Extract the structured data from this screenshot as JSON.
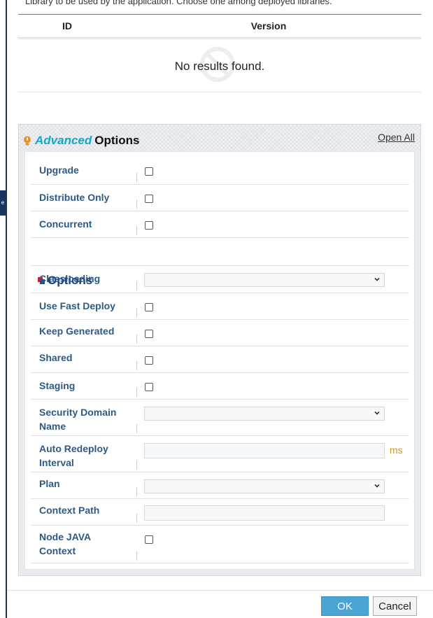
{
  "library": {
    "description": "Library to be used by the application. Choose one among deployed libraries.",
    "columns": [
      "ID",
      "Version"
    ],
    "empty_text": "No results found."
  },
  "advanced": {
    "title_part1": "Advanced",
    "title_part2": "Options",
    "open_all": "Open All",
    "rows_top": [
      {
        "label": "Upgrade",
        "control": "checkbox",
        "checked": false
      },
      {
        "label": "Distribute Only",
        "control": "checkbox",
        "checked": false
      },
      {
        "label": "Concurrent",
        "control": "checkbox",
        "checked": false
      }
    ],
    "options_title": "Options",
    "rows_options": [
      {
        "label": "Classloading",
        "control": "select",
        "value": ""
      },
      {
        "label": "Use Fast Deploy",
        "control": "checkbox",
        "checked": false
      },
      {
        "label": "Keep Generated",
        "control": "checkbox",
        "checked": false
      },
      {
        "label": "Shared",
        "control": "checkbox",
        "checked": false
      },
      {
        "label": "Staging",
        "control": "checkbox",
        "checked": false
      },
      {
        "label": "Security Domain Name",
        "control": "select",
        "value": ""
      },
      {
        "label": "Auto Redeploy Interval",
        "control": "text",
        "value": "",
        "unit": "ms"
      },
      {
        "label": "Plan",
        "control": "select",
        "value": ""
      },
      {
        "label": "Context Path",
        "control": "text",
        "value": ""
      },
      {
        "label": "Node JAVA Context",
        "control": "checkbox",
        "checked": false
      }
    ]
  },
  "footer": {
    "ok": "OK",
    "cancel": "Cancel"
  },
  "side_tab_text": "e",
  "colors": {
    "accent": "#12a7c9",
    "label": "#2c5a86",
    "ok_button": "#4aa4d4",
    "unit": "#d39a1b"
  }
}
